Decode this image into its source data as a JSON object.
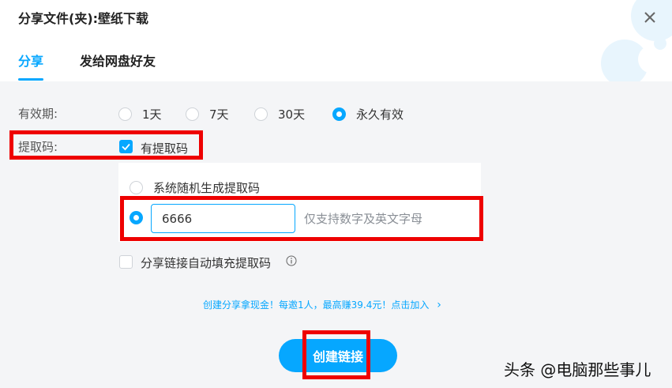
{
  "dialog": {
    "title": "分享文件(夹):壁纸下载"
  },
  "tabs": [
    {
      "label": "分享",
      "active": true
    },
    {
      "label": "发给网盘好友",
      "active": false
    }
  ],
  "validity": {
    "label": "有效期:",
    "options": [
      "1天",
      "7天",
      "30天",
      "永久有效"
    ],
    "selected": "永久有效"
  },
  "extract_code": {
    "label": "提取码:",
    "checkbox_label": "有提取码",
    "checked": true,
    "random_option_label": "系统随机生成提取码",
    "custom_value": "6666",
    "hint": "仅支持数字及英文字母",
    "autofill_label": "分享链接自动填充提取码",
    "autofill_checked": false
  },
  "promo": {
    "text": "创建分享拿现金！每邀1人，最高赚39.4元！点击加入",
    "arrow": "›"
  },
  "actions": {
    "create_label": "创建链接"
  },
  "watermark": {
    "text": "头条 @电脑那些事儿"
  },
  "colors": {
    "accent": "#06a7ff",
    "highlight": "#ee0000",
    "panel_bg": "#f4f5f7"
  }
}
